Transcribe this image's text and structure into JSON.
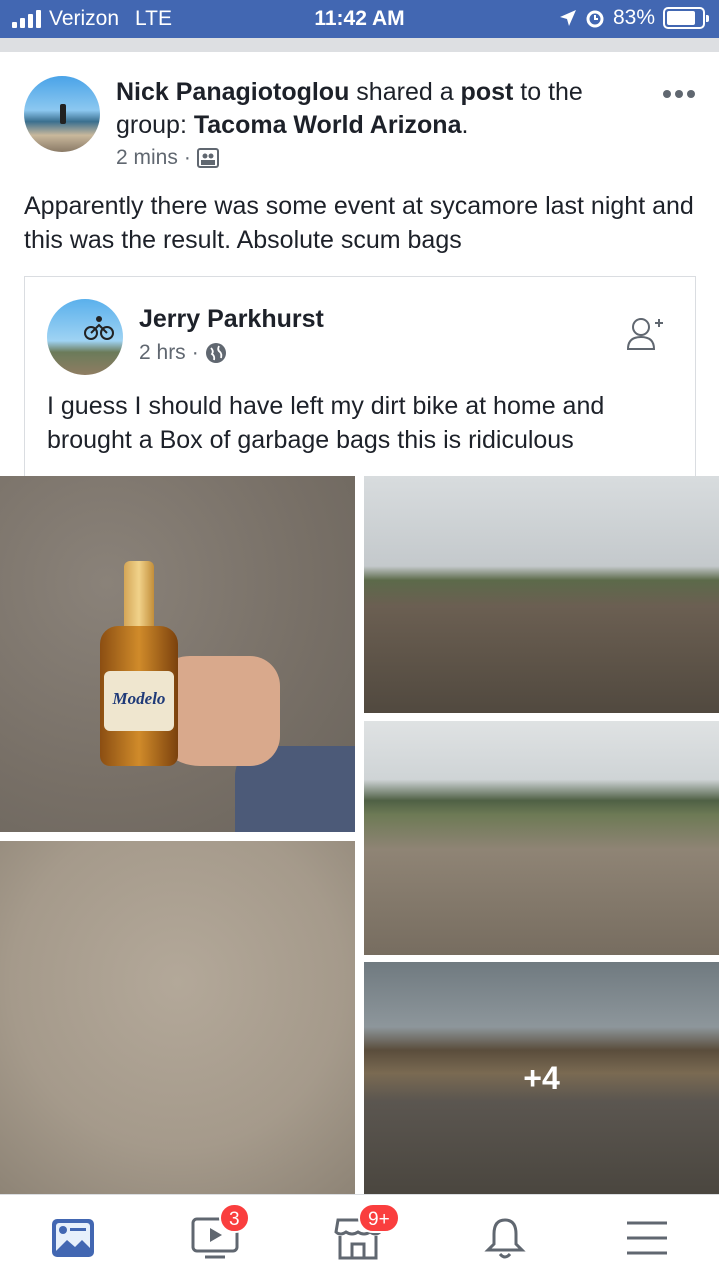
{
  "status_bar": {
    "carrier": "Verizon",
    "network": "LTE",
    "time": "11:42 AM",
    "battery": "83%"
  },
  "post": {
    "author": "Nick Panagiotoglou",
    "action": " shared a ",
    "object": "post",
    "to_text": " to the group: ",
    "group": "Tacoma World Arizona",
    "trail": ".",
    "time": "2 mins",
    "dot": "·",
    "audience_icon": "group-icon",
    "body": "Apparently there was some event at sycamore last night and this was the result. Absolute scum bags"
  },
  "shared_post": {
    "author": "Jerry Parkhurst",
    "time": "2 hrs",
    "dot": "·",
    "audience_icon": "globe-icon",
    "body": "I guess I should have left my dirt bike at home and brought a Box of garbage bags this is ridiculous"
  },
  "photos": {
    "bottle_label": "Modelo",
    "more_count": "+4"
  },
  "tab_bar": {
    "tabs": [
      {
        "name": "news-feed",
        "icon": "news-feed-icon",
        "badge": ""
      },
      {
        "name": "watch",
        "icon": "watch-icon",
        "badge": "3"
      },
      {
        "name": "marketplace",
        "icon": "marketplace-icon",
        "badge": "9+"
      },
      {
        "name": "notifications",
        "icon": "bell-icon",
        "badge": ""
      },
      {
        "name": "menu",
        "icon": "menu-icon",
        "badge": ""
      }
    ]
  },
  "colors": {
    "brand": "#4267b2",
    "badge": "#fa3e3e",
    "text": "#1d2129",
    "muted": "#606770"
  }
}
